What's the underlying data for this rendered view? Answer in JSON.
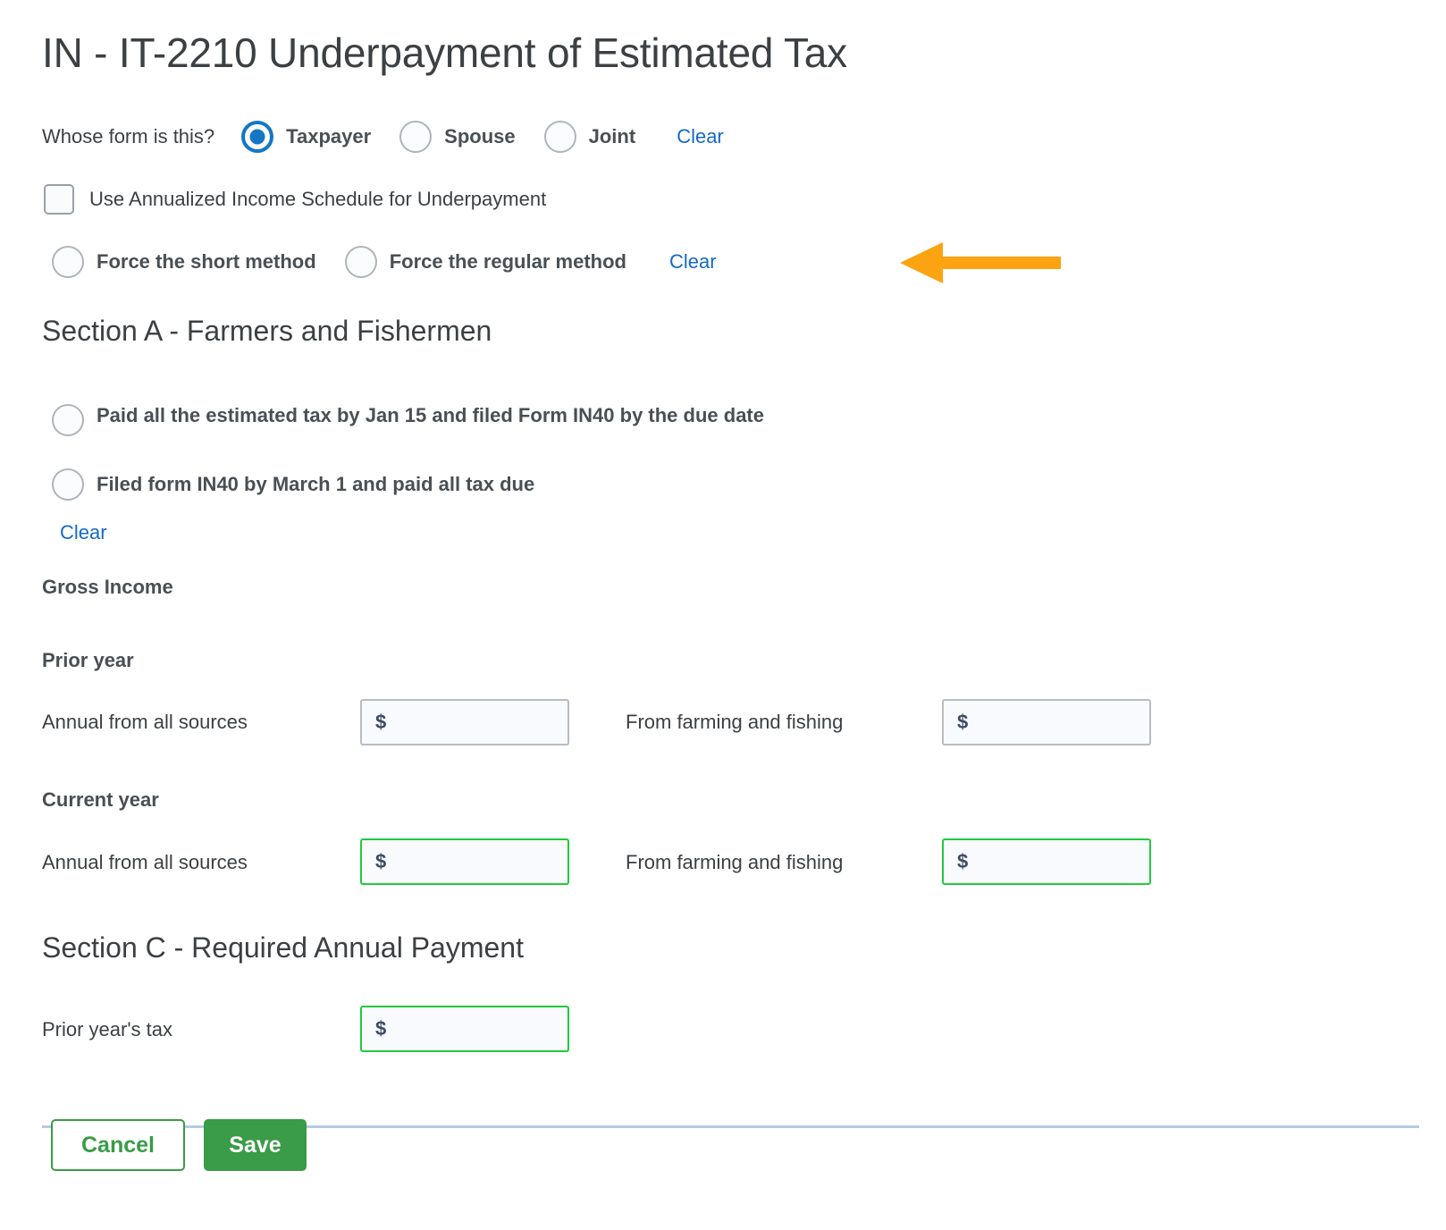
{
  "page": {
    "title": "IN - IT-2210 Underpayment of Estimated Tax",
    "background_color": "#ffffff"
  },
  "colors": {
    "accent_blue": "#1577c4",
    "link_blue": "#1669c7",
    "input_green": "#22c93d",
    "button_green": "#3a9b48",
    "annotation_orange": "#fca311",
    "divider": "#b3cce4",
    "text": "#3c4043"
  },
  "whose_form": {
    "label": "Whose form is this?",
    "options": [
      {
        "label": "Taxpayer",
        "selected": true
      },
      {
        "label": "Spouse",
        "selected": false
      },
      {
        "label": "Joint",
        "selected": false
      }
    ],
    "clear_label": "Clear"
  },
  "annualized": {
    "checkbox_label": "Use Annualized Income Schedule for Underpayment",
    "checked": false
  },
  "force_method": {
    "options": [
      {
        "label": "Force the short method",
        "selected": false
      },
      {
        "label": "Force the regular method",
        "selected": false
      }
    ],
    "clear_label": "Clear"
  },
  "annotation": {
    "type": "arrow-left",
    "color": "#fca311"
  },
  "section_a": {
    "heading": "Section A - Farmers and Fishermen",
    "options": [
      {
        "label": "Paid all the estimated tax by Jan 15 and filed Form IN40 by the due date",
        "selected": false
      },
      {
        "label": "Filed form IN40 by March 1 and paid all tax due",
        "selected": false
      }
    ],
    "clear_label": "Clear",
    "gross_income_heading": "Gross Income",
    "prior_year": {
      "heading": "Prior year",
      "fields": [
        {
          "label": "Annual from all sources",
          "value": "",
          "prefix": "$",
          "highlight": false
        },
        {
          "label": "From farming and fishing",
          "value": "",
          "prefix": "$",
          "highlight": false
        }
      ]
    },
    "current_year": {
      "heading": "Current year",
      "fields": [
        {
          "label": "Annual from all sources",
          "value": "",
          "prefix": "$",
          "highlight": true
        },
        {
          "label": "From farming and fishing",
          "value": "",
          "prefix": "$",
          "highlight": true
        }
      ]
    }
  },
  "section_c": {
    "heading": "Section C - Required Annual Payment",
    "fields": [
      {
        "label": "Prior year's tax",
        "value": "",
        "prefix": "$",
        "highlight": true
      }
    ]
  },
  "footer": {
    "cancel_label": "Cancel",
    "save_label": "Save"
  }
}
